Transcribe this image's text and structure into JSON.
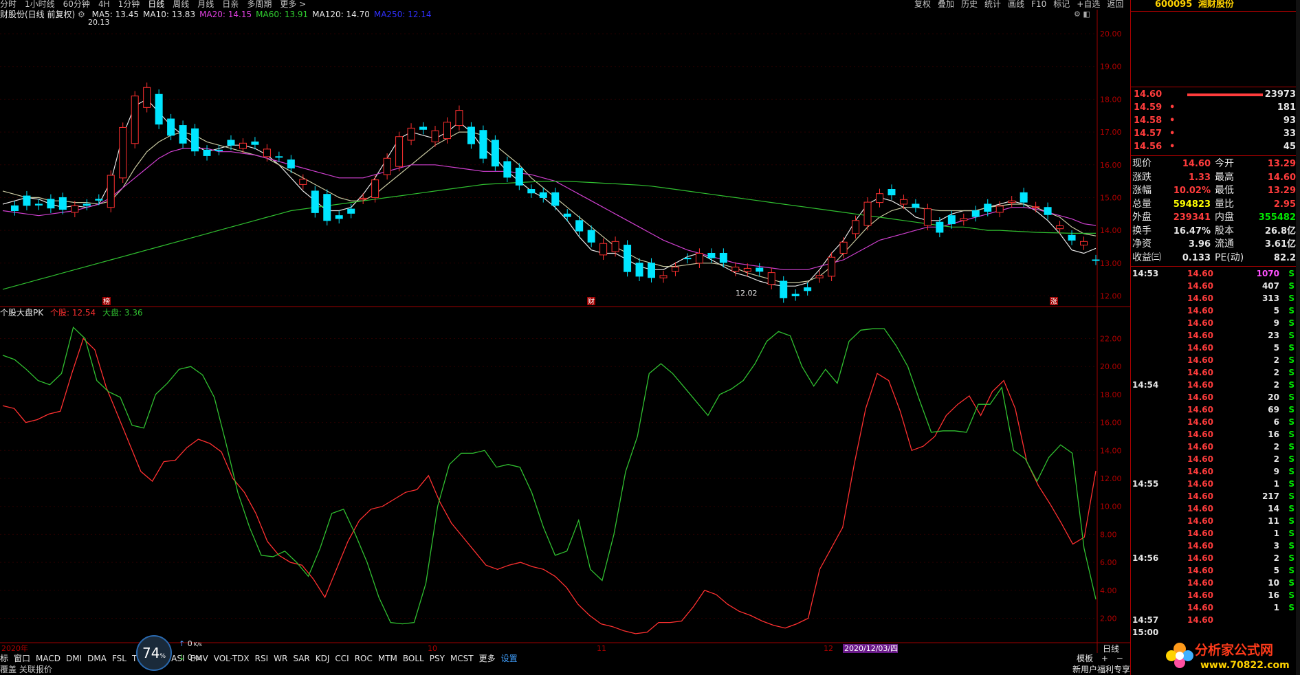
{
  "top_tabs": [
    "分时",
    "1小时线",
    "60分钟",
    "4H",
    "1分钟",
    "日线",
    "周线",
    "月线",
    "日亲",
    "多周期",
    "更多 >"
  ],
  "top_active": "日线",
  "top_right_menu": [
    "复权",
    "叠加",
    "历史",
    "统计",
    "画线",
    "F10",
    "标记",
    "+自选",
    "返回"
  ],
  "chart_info": {
    "stock_label": "财股份(日线 前复权)",
    "ma": [
      {
        "label": "MA5: 13.45",
        "color": "#e6e6e6"
      },
      {
        "label": "MA10: 13.83",
        "color": "#e6e6e6"
      },
      {
        "label": "MA20: 14.15",
        "color": "#e040e0"
      },
      {
        "label": "MA60: 13.91",
        "color": "#30d030"
      },
      {
        "label": "MA120: 14.70",
        "color": "#e6e6e6"
      },
      {
        "label": "MA250: 12.14",
        "color": "#3030ff"
      }
    ]
  },
  "chart_data": [
    {
      "type": "candlestick",
      "title": "财股份(日线 前复权)",
      "y_ticks": [
        "20.00",
        "19.00",
        "18.00",
        "17.00",
        "16.00",
        "15.00",
        "14.00",
        "13.00",
        "12.00"
      ],
      "ylim": [
        11.8,
        20.4
      ],
      "annotations": [
        "20.13",
        "12.02"
      ],
      "event_markers": [
        "榜",
        "财",
        "涨"
      ],
      "series": [
        {
          "name": "MA5",
          "values": [
            14.8,
            14.9,
            15.0,
            14.95,
            14.8,
            14.7,
            14.75,
            14.7,
            14.8,
            15.5,
            16.9,
            17.8,
            18.0,
            17.6,
            17.2,
            16.9,
            16.6,
            16.4,
            16.5,
            16.6,
            16.6,
            16.5,
            16.3,
            16.0,
            15.6,
            15.2,
            14.9,
            14.6,
            14.6,
            14.7,
            15.1,
            15.6,
            16.2,
            16.8,
            17.0,
            16.9,
            16.8,
            17.0,
            17.3,
            17.0,
            16.5,
            16.2,
            15.8,
            15.5,
            15.2,
            15.0,
            14.7,
            14.3,
            13.8,
            13.4,
            13.3,
            13.3,
            13.1,
            12.9,
            12.8,
            12.8,
            13.0,
            13.2,
            13.3,
            13.1,
            12.9,
            12.7,
            12.6,
            12.45,
            12.35,
            12.3,
            12.3,
            12.4,
            12.8,
            13.3,
            13.7,
            14.3,
            14.8,
            15.0,
            14.9,
            14.7,
            14.4,
            14.3,
            14.3,
            14.5,
            14.6,
            14.6,
            14.7,
            14.8,
            14.9,
            14.8,
            14.6,
            14.3,
            13.9,
            13.4,
            13.3,
            13.45
          ]
        },
        {
          "name": "MA10",
          "values": [
            15.2,
            15.1,
            15.0,
            15.0,
            14.9,
            14.9,
            14.85,
            14.85,
            14.8,
            14.9,
            15.3,
            15.9,
            16.4,
            16.7,
            16.9,
            17.0,
            16.9,
            16.7,
            16.6,
            16.5,
            16.4,
            16.3,
            16.2,
            16.0,
            15.8,
            15.6,
            15.4,
            15.2,
            15.0,
            14.9,
            14.9,
            15.1,
            15.4,
            15.7,
            16.0,
            16.3,
            16.6,
            16.8,
            17.0,
            17.0,
            16.9,
            16.6,
            16.3,
            16.0,
            15.6,
            15.3,
            15.0,
            14.7,
            14.4,
            14.1,
            13.8,
            13.5,
            13.3,
            13.1,
            13.0,
            12.9,
            12.9,
            12.95,
            13.0,
            13.0,
            12.95,
            12.85,
            12.7,
            12.6,
            12.5,
            12.4,
            12.4,
            12.45,
            12.6,
            12.9,
            13.3,
            13.7,
            14.1,
            14.4,
            14.6,
            14.7,
            14.7,
            14.65,
            14.6,
            14.6,
            14.6,
            14.6,
            14.7,
            14.75,
            14.8,
            14.8,
            14.7,
            14.55,
            14.4,
            14.1,
            13.9,
            13.83
          ]
        },
        {
          "name": "MA20",
          "values": [
            14.6,
            14.55,
            14.5,
            14.45,
            14.5,
            14.55,
            14.6,
            14.7,
            14.8,
            15.0,
            15.3,
            15.6,
            15.9,
            16.2,
            16.4,
            16.5,
            16.5,
            16.5,
            16.4,
            16.4,
            16.35,
            16.3,
            16.2,
            16.1,
            16.0,
            15.9,
            15.8,
            15.7,
            15.6,
            15.6,
            15.6,
            15.7,
            15.8,
            15.9,
            16.0,
            16.0,
            16.0,
            15.95,
            15.9,
            15.85,
            15.8,
            15.8,
            15.8,
            15.75,
            15.7,
            15.6,
            15.5,
            15.3,
            15.1,
            14.9,
            14.7,
            14.5,
            14.3,
            14.1,
            13.9,
            13.7,
            13.55,
            13.4,
            13.3,
            13.2,
            13.1,
            13.0,
            12.95,
            12.9,
            12.85,
            12.8,
            12.8,
            12.8,
            12.9,
            13.0,
            13.1,
            13.3,
            13.5,
            13.7,
            13.8,
            13.9,
            14.0,
            14.1,
            14.1,
            14.2,
            14.3,
            14.4,
            14.5,
            14.6,
            14.7,
            14.7,
            14.65,
            14.55,
            14.45,
            14.35,
            14.2,
            14.15
          ]
        },
        {
          "name": "MA60",
          "values": [
            12.2,
            12.3,
            12.4,
            12.5,
            12.6,
            12.7,
            12.8,
            12.9,
            13.0,
            13.1,
            13.2,
            13.3,
            13.4,
            13.5,
            13.6,
            13.7,
            13.8,
            13.9,
            14.0,
            14.1,
            14.2,
            14.3,
            14.4,
            14.5,
            14.6,
            14.65,
            14.7,
            14.75,
            14.8,
            14.85,
            14.9,
            14.95,
            15.0,
            15.05,
            15.1,
            15.15,
            15.2,
            15.25,
            15.3,
            15.35,
            15.4,
            15.42,
            15.44,
            15.46,
            15.48,
            15.5,
            15.5,
            15.5,
            15.48,
            15.46,
            15.44,
            15.42,
            15.4,
            15.38,
            15.35,
            15.3,
            15.25,
            15.2,
            15.15,
            15.1,
            15.05,
            15.0,
            14.95,
            14.9,
            14.85,
            14.8,
            14.75,
            14.7,
            14.65,
            14.6,
            14.55,
            14.5,
            14.45,
            14.4,
            14.35,
            14.3,
            14.25,
            14.2,
            14.15,
            14.1,
            14.1,
            14.05,
            14.0,
            14.0,
            13.98,
            13.96,
            13.94,
            13.93,
            13.92,
            13.91,
            13.91,
            13.91
          ]
        }
      ]
    },
    {
      "type": "line",
      "title": "个股大盘PK",
      "legend": [
        {
          "name": "个股",
          "value": "12.54",
          "color": "#ff3030"
        },
        {
          "name": "大盘",
          "value": "3.36",
          "color": "#30c030"
        }
      ],
      "y_ticks": [
        "22.00",
        "20.00",
        "18.00",
        "16.00",
        "14.00",
        "12.00",
        "10.00",
        "8.00",
        "6.00",
        "4.00",
        "2.00"
      ],
      "ylim": [
        0.5,
        23.5
      ],
      "series": [
        {
          "name": "个股",
          "values": [
            17.2,
            17.0,
            16.0,
            16.2,
            16.6,
            16.8,
            19.5,
            22.0,
            21.2,
            18.5,
            16.5,
            14.5,
            12.5,
            11.8,
            13.2,
            13.3,
            14.2,
            14.8,
            14.5,
            13.9,
            12.0,
            11.0,
            9.5,
            7.5,
            6.5,
            6.0,
            5.8,
            4.8,
            3.5,
            5.5,
            7.5,
            9.0,
            9.8,
            10.0,
            10.5,
            11.0,
            11.2,
            12.2,
            10.3,
            8.8,
            7.8,
            6.8,
            5.8,
            5.5,
            5.8,
            6.0,
            5.7,
            5.5,
            5.0,
            4.2,
            3.0,
            2.2,
            1.6,
            1.4,
            1.1,
            0.9,
            1.0,
            1.7,
            1.7,
            1.8,
            2.8,
            4.0,
            3.7,
            3.0,
            2.5,
            2.2,
            1.8,
            1.5,
            1.3,
            1.6,
            2.0,
            5.5,
            7.0,
            8.5,
            13.0,
            17.0,
            19.5,
            19.0,
            16.8,
            14.0,
            14.3,
            15.0,
            16.5,
            17.3,
            17.9,
            16.5,
            18.2,
            19.0,
            17.0,
            13.2,
            11.5,
            10.2,
            8.8,
            7.3,
            7.8,
            12.54
          ]
        },
        {
          "name": "大盘",
          "values": [
            20.8,
            20.5,
            19.8,
            19.0,
            18.7,
            19.5,
            22.8,
            22.0,
            19.0,
            18.2,
            17.8,
            15.8,
            15.6,
            18.0,
            18.8,
            19.8,
            20.0,
            19.4,
            17.8,
            14.5,
            11.0,
            8.5,
            6.5,
            6.4,
            6.8,
            6.0,
            5.0,
            7.0,
            9.5,
            9.8,
            8.0,
            6.0,
            3.5,
            1.7,
            1.6,
            1.7,
            4.5,
            10.0,
            13.0,
            13.8,
            13.8,
            14.0,
            12.8,
            13.0,
            12.8,
            11.0,
            8.5,
            6.5,
            6.8,
            9.0,
            5.5,
            4.7,
            8.0,
            12.5,
            15.0,
            19.5,
            20.2,
            19.5,
            18.5,
            17.5,
            16.5,
            18.0,
            18.4,
            19.0,
            20.2,
            21.8,
            22.5,
            22.2,
            20.0,
            18.6,
            19.8,
            18.8,
            21.8,
            22.6,
            22.7,
            22.7,
            21.5,
            20.0,
            17.6,
            15.3,
            15.4,
            15.4,
            15.3,
            17.3,
            17.3,
            18.5,
            14.0,
            13.4,
            11.8,
            13.5,
            14.4,
            13.8,
            7.0,
            3.36
          ]
        }
      ]
    }
  ],
  "x_axis": {
    "labels": [
      {
        "text": "2020年"
      },
      {
        "text": "10"
      },
      {
        "text": "11"
      },
      {
        "text": "12"
      },
      {
        "text": "2020/12/03/四",
        "highlight": true
      }
    ]
  },
  "bottom_toolbar": [
    "标",
    "窗口",
    "MACD",
    "DMI",
    "DMA",
    "FSL",
    "TR",
    "OBV",
    "ASI",
    "EMV",
    "VOL-TDX",
    "RSI",
    "WR",
    "SAR",
    "KDJ",
    "CCI",
    "ROC",
    "MTM",
    "BOLL",
    "PSY",
    "MCST",
    "更多",
    "设置"
  ],
  "bottom_right": {
    "period": "日线",
    "template": "模板",
    "plus": "+",
    "minus": "−"
  },
  "status_bar": {
    "left": "覆盖  关联报价",
    "right": "新用户福利专享"
  },
  "network_widget": {
    "cpu": "74",
    "cpu_unit": "%",
    "up": "0",
    "down": "0",
    "unit": "K/s"
  },
  "right_panel": {
    "stock_code": "600095",
    "stock_name": "湘财股份",
    "order_book": [
      {
        "price": "14.60",
        "vol": "23973"
      },
      {
        "price": "14.59",
        "vol": "181"
      },
      {
        "price": "14.58",
        "vol": "93"
      },
      {
        "price": "14.57",
        "vol": "33"
      },
      {
        "price": "14.56",
        "vol": "45"
      }
    ],
    "quote": [
      {
        "l1": "现价",
        "v1": "14.60",
        "l2": "今开",
        "v2": "13.29"
      },
      {
        "l1": "涨跌",
        "v1": "1.33",
        "l2": "最高",
        "v2": "14.60"
      },
      {
        "l1": "涨幅",
        "v1": "10.02%",
        "l2": "最低",
        "v2": "13.29"
      },
      {
        "l1": "总量",
        "v1": "594823",
        "l2": "量比",
        "v2": "2.95"
      },
      {
        "l1": "外盘",
        "v1": "239341",
        "l2": "内盘",
        "v2": "355482"
      },
      {
        "l1": "换手",
        "v1": "16.47%",
        "l2": "股本",
        "v2": "26.8亿"
      },
      {
        "l1": "净资",
        "v1": "3.96",
        "l2": "流通",
        "v2": "3.61亿"
      },
      {
        "l1": "收益㈢",
        "v1": "0.133",
        "l2": "PE(动)",
        "v2": "82.2"
      }
    ],
    "ticks": [
      {
        "t": "14:53",
        "p": "14.60",
        "v": "1070",
        "s": "S"
      },
      {
        "t": "",
        "p": "14.60",
        "v": "407",
        "s": "S"
      },
      {
        "t": "",
        "p": "14.60",
        "v": "313",
        "s": "S"
      },
      {
        "t": "",
        "p": "14.60",
        "v": "5",
        "s": "S"
      },
      {
        "t": "",
        "p": "14.60",
        "v": "9",
        "s": "S"
      },
      {
        "t": "",
        "p": "14.60",
        "v": "23",
        "s": "S"
      },
      {
        "t": "",
        "p": "14.60",
        "v": "5",
        "s": "S"
      },
      {
        "t": "",
        "p": "14.60",
        "v": "2",
        "s": "S"
      },
      {
        "t": "",
        "p": "14.60",
        "v": "2",
        "s": "S"
      },
      {
        "t": "14:54",
        "p": "14.60",
        "v": "2",
        "s": "S"
      },
      {
        "t": "",
        "p": "14.60",
        "v": "20",
        "s": "S"
      },
      {
        "t": "",
        "p": "14.60",
        "v": "69",
        "s": "S"
      },
      {
        "t": "",
        "p": "14.60",
        "v": "6",
        "s": "S"
      },
      {
        "t": "",
        "p": "14.60",
        "v": "16",
        "s": "S"
      },
      {
        "t": "",
        "p": "14.60",
        "v": "2",
        "s": "S"
      },
      {
        "t": "",
        "p": "14.60",
        "v": "2",
        "s": "S"
      },
      {
        "t": "",
        "p": "14.60",
        "v": "9",
        "s": "S"
      },
      {
        "t": "14:55",
        "p": "14.60",
        "v": "1",
        "s": "S"
      },
      {
        "t": "",
        "p": "14.60",
        "v": "217",
        "s": "S"
      },
      {
        "t": "",
        "p": "14.60",
        "v": "14",
        "s": "S"
      },
      {
        "t": "",
        "p": "14.60",
        "v": "11",
        "s": "S"
      },
      {
        "t": "",
        "p": "14.60",
        "v": "1",
        "s": "S"
      },
      {
        "t": "",
        "p": "14.60",
        "v": "3",
        "s": "S"
      },
      {
        "t": "14:56",
        "p": "14.60",
        "v": "2",
        "s": "S"
      },
      {
        "t": "",
        "p": "14.60",
        "v": "5",
        "s": "S"
      },
      {
        "t": "",
        "p": "14.60",
        "v": "10",
        "s": "S"
      },
      {
        "t": "",
        "p": "14.60",
        "v": "16",
        "s": "S"
      },
      {
        "t": "",
        "p": "14.60",
        "v": "1",
        "s": "S"
      },
      {
        "t": "14:57",
        "p": "14.60",
        "v": "",
        "s": ""
      },
      {
        "t": "15:00",
        "p": "",
        "v": "",
        "s": ""
      }
    ]
  },
  "watermark": {
    "text": "分析家公式网",
    "url": "www.70822.com"
  }
}
